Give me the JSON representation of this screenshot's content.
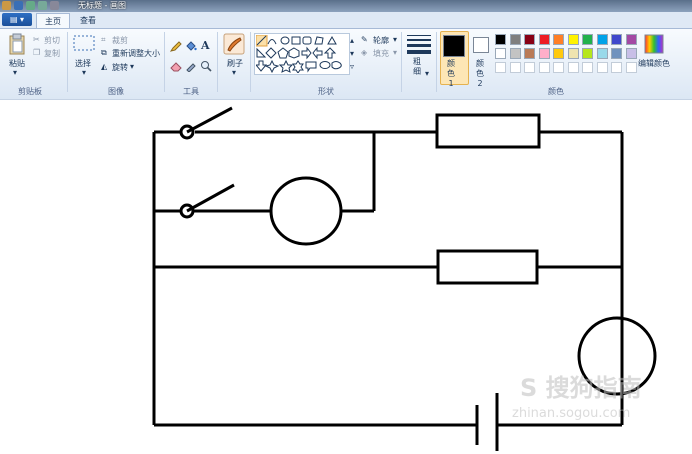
{
  "window": {
    "title": "无标题 - 画图",
    "app_menu": "▤ ▾"
  },
  "tabs": [
    "主页",
    "查看"
  ],
  "clipboard": {
    "paste": "粘贴",
    "cut": "剪切",
    "copy": "复制",
    "group": "剪贴板"
  },
  "image": {
    "select": "选择",
    "crop": "裁剪",
    "resize": "重新调整大小",
    "rotate": "旋转",
    "group": "图像"
  },
  "tools": {
    "group": "工具"
  },
  "brushes": {
    "label": "刷子"
  },
  "shapes": {
    "outline": "轮廓",
    "fill": "填充",
    "group": "形状"
  },
  "size": {
    "label": "粗细"
  },
  "colors": {
    "color1_label": "颜色 1",
    "color2_label": "颜色 2",
    "edit_label": "编辑颜色",
    "group": "颜色",
    "color1": "#000000",
    "color2": "#ffffff",
    "palette_row1": [
      "#000000",
      "#7f7f7f",
      "#880015",
      "#ed1c24",
      "#ff7f27",
      "#fff200",
      "#22b14c",
      "#00a2e8",
      "#3f48cc",
      "#a349a4"
    ],
    "palette_row2": [
      "#ffffff",
      "#c3c3c3",
      "#b97a57",
      "#ffaec9",
      "#ffc90e",
      "#efe4b0",
      "#b5e61d",
      "#99d9ea",
      "#7092be",
      "#c8bfe7"
    ]
  },
  "watermark": {
    "main": "S 搜狗指南",
    "url": "zhinan.sogou.com"
  }
}
